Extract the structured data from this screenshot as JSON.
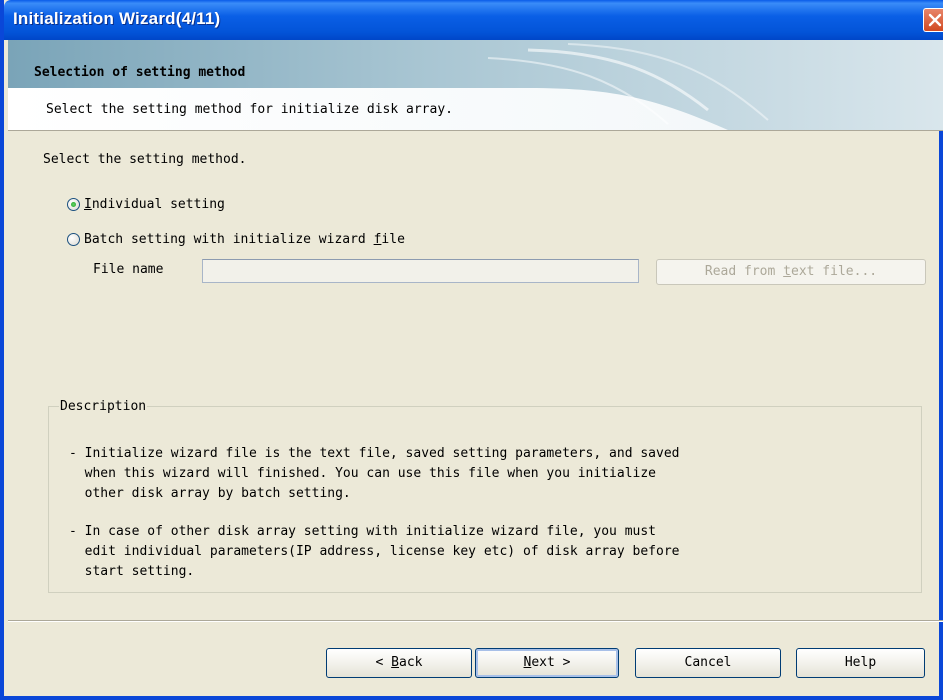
{
  "window": {
    "title": "Initialization Wizard(4/11)"
  },
  "banner": {
    "title": "Selection of setting method",
    "subtitle": "Select the setting method for initialize disk array."
  },
  "main": {
    "prompt": "Select the setting method.",
    "options": [
      {
        "pre": "",
        "u": "I",
        "post": "ndividual setting",
        "selected": true
      },
      {
        "pre": "Batch setting with initialize wizard ",
        "u": "f",
        "post": "ile",
        "selected": false
      }
    ],
    "file_label": "File name",
    "file_value": "",
    "read_button": {
      "pre": "Read from ",
      "u": "t",
      "post": "ext file..."
    }
  },
  "description": {
    "legend": "Description",
    "items": [
      "- Initialize wizard file is the text file, saved setting parameters, and saved\n  when this wizard will finished. You can use this file when you initialize\n  other disk array by batch setting.",
      "- In case of other disk array setting with initialize wizard file, you must\n  edit individual parameters(IP address, license key etc) of disk array before\n  start setting."
    ]
  },
  "buttons": {
    "back": {
      "pre": "< ",
      "u": "B",
      "post": "ack"
    },
    "next": {
      "pre": "",
      "u": "N",
      "post": "ext >"
    },
    "cancel": "Cancel",
    "help": "Help"
  },
  "colors": {
    "titlebar": "#0a5fe6",
    "face": "#ece9d8",
    "close": "#d24a22"
  }
}
